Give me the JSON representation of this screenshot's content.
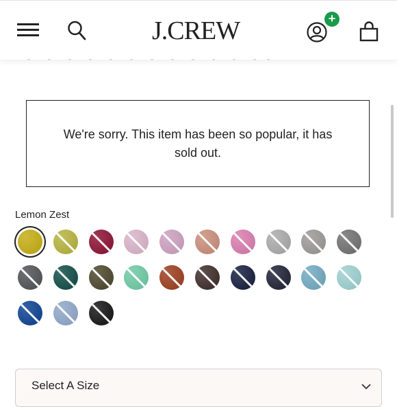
{
  "header": {
    "logo": "J.CREW",
    "icons": [
      "menu-icon",
      "search-icon",
      "account-icon",
      "plus-icon",
      "bag-icon"
    ]
  },
  "notice": {
    "message": "We're sorry. This item has been so popular, it has sold out."
  },
  "color_picker": {
    "selected_label": "Lemon Zest",
    "swatches": [
      {
        "color": "#c4ac10",
        "selected": true
      },
      {
        "color": "#b5b23a"
      },
      {
        "color": "#8a0f30"
      },
      {
        "color": "#d9b2c9"
      },
      {
        "color": "#cc9fbf"
      },
      {
        "color": "#c98c78"
      },
      {
        "color": "#d97aad"
      },
      {
        "color": "#a9a9a9"
      },
      {
        "color": "#9a9794"
      },
      {
        "color": "#6f6f6f"
      },
      {
        "color": "#4f5053"
      },
      {
        "color": "#0d4a44"
      },
      {
        "color": "#4a4428"
      },
      {
        "color": "#6cc9a3"
      },
      {
        "color": "#9a3b1b"
      },
      {
        "color": "#3b2a26"
      },
      {
        "color": "#121a3b"
      },
      {
        "color": "#1b1f33"
      },
      {
        "color": "#6fa8c0"
      },
      {
        "color": "#9ccfcf"
      },
      {
        "color": "#0a3f91"
      },
      {
        "color": "#8ea6c8"
      },
      {
        "color": "#121212"
      }
    ]
  },
  "size_select": {
    "label": "Select A Size"
  }
}
